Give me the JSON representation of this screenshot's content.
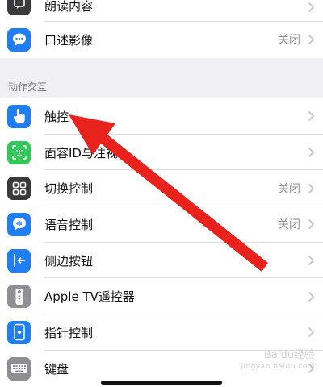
{
  "colors": {
    "background": "#efeff4",
    "arrow": "#e8231e",
    "icon_blue": "#1f7ff2",
    "icon_green": "#34c759",
    "icon_dark": "#3a3a3c",
    "icon_gray": "#8e8e93"
  },
  "group1": {
    "items": [
      {
        "label": "朗读内容",
        "value": "",
        "icon": "speech-bubble-icon"
      },
      {
        "label": "口述影像",
        "value": "关闭",
        "icon": "chat-bubble-icon"
      }
    ]
  },
  "section_header": "动作交互",
  "group2": {
    "items": [
      {
        "label": "触控",
        "value": "",
        "icon": "hand-touch-icon"
      },
      {
        "label": "面容ID与注视",
        "value": "",
        "icon": "face-id-icon"
      },
      {
        "label": "切换控制",
        "value": "关闭",
        "icon": "grid-icon"
      },
      {
        "label": "语音控制",
        "value": "关闭",
        "icon": "voice-control-icon"
      },
      {
        "label": "侧边按钮",
        "value": "",
        "icon": "side-button-icon"
      },
      {
        "label": "Apple TV遥控器",
        "value": "",
        "icon": "remote-icon"
      },
      {
        "label": "指针控制",
        "value": "",
        "icon": "pointer-icon"
      },
      {
        "label": "键盘",
        "value": "",
        "icon": "keyboard-icon"
      }
    ]
  },
  "watermark": {
    "line1": "Baidu经验",
    "line2": "jingyan.baidu.com"
  }
}
